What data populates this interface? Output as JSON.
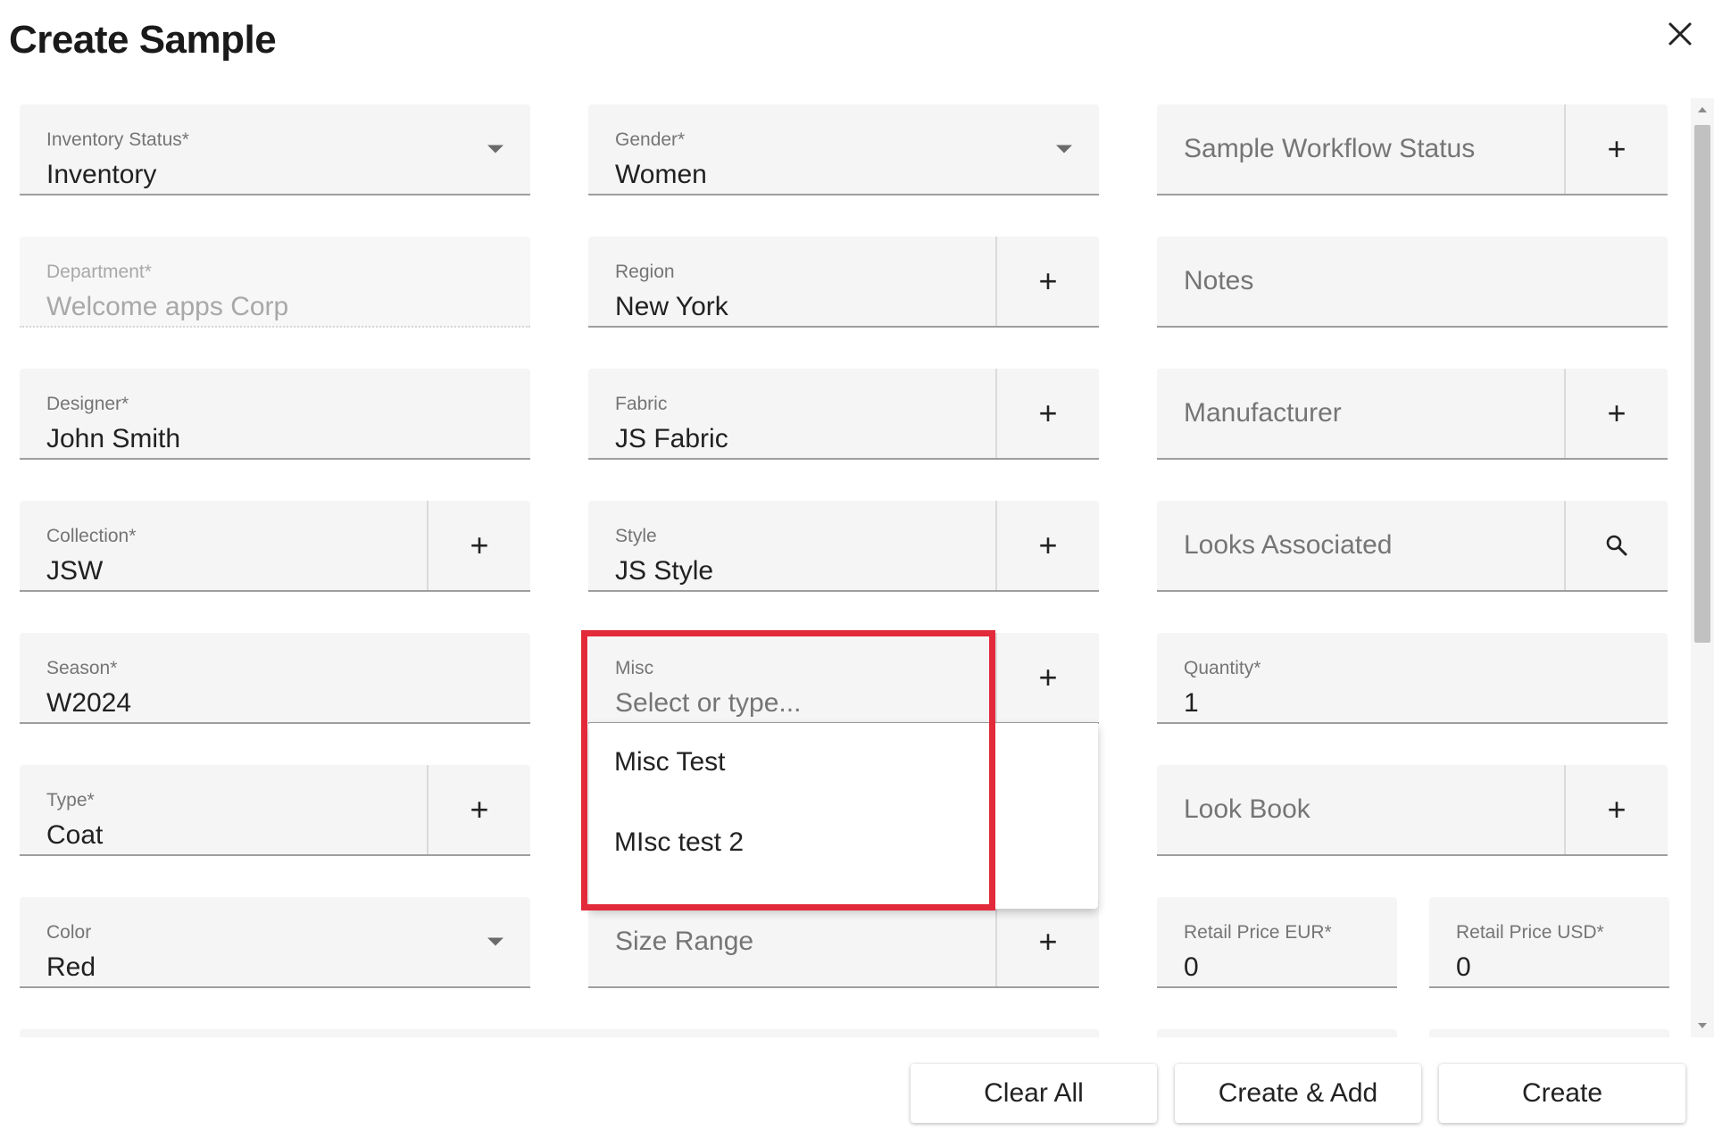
{
  "dialog": {
    "title": "Create Sample"
  },
  "fields": {
    "inventory_status": {
      "label": "Inventory Status*",
      "value": "Inventory"
    },
    "gender": {
      "label": "Gender*",
      "value": "Women"
    },
    "sample_workflow_status": {
      "placeholder": "Sample Workflow Status"
    },
    "department": {
      "label": "Department*",
      "value": "Welcome apps Corp"
    },
    "region": {
      "label": "Region",
      "value": "New York"
    },
    "notes": {
      "placeholder": "Notes"
    },
    "designer": {
      "label": "Designer*",
      "value": "John Smith"
    },
    "fabric": {
      "label": "Fabric",
      "value": "JS Fabric"
    },
    "manufacturer": {
      "placeholder": "Manufacturer"
    },
    "collection": {
      "label": "Collection*",
      "value": "JSW"
    },
    "style": {
      "label": "Style",
      "value": "JS Style"
    },
    "looks_associated": {
      "placeholder": "Looks Associated"
    },
    "season": {
      "label": "Season*",
      "value": "W2024"
    },
    "misc": {
      "label": "Misc",
      "placeholder": "Select or type..."
    },
    "quantity": {
      "label": "Quantity*",
      "value": "1"
    },
    "type": {
      "label": "Type*",
      "value": "Coat"
    },
    "look_book": {
      "placeholder": "Look Book"
    },
    "color": {
      "label": "Color",
      "value": "Red"
    },
    "size_range": {
      "placeholder": "Size Range"
    },
    "retail_price_eur": {
      "label": "Retail Price EUR*",
      "value": "0"
    },
    "retail_price_usd": {
      "label": "Retail Price USD*",
      "value": "0"
    }
  },
  "misc_dropdown": {
    "options": [
      "Misc Test",
      "MIsc test 2"
    ]
  },
  "icons": {
    "add": "+",
    "close": "close-icon",
    "search": "search-icon",
    "dropdown": "arrow-drop-down-icon"
  },
  "footer": {
    "clear_all": "Clear All",
    "create_and_add": "Create & Add",
    "create": "Create"
  },
  "colors": {
    "highlight": "#e32a3a",
    "field_bg": "#f5f5f5"
  }
}
